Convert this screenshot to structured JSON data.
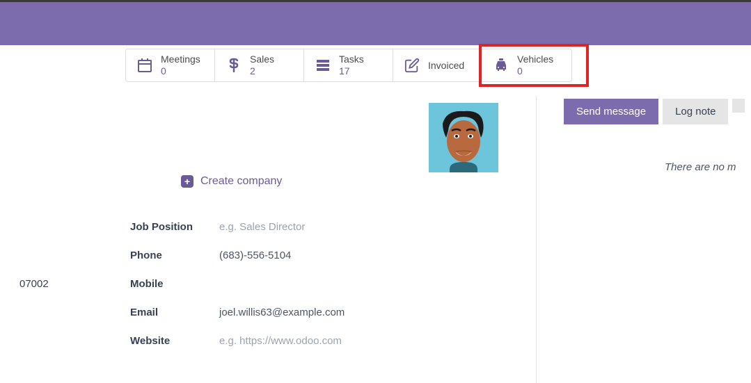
{
  "stats": {
    "meetings": {
      "label": "Meetings",
      "value": "0"
    },
    "sales": {
      "label": "Sales",
      "value": "2"
    },
    "tasks": {
      "label": "Tasks",
      "value": "17"
    },
    "invoiced": {
      "label": "Invoiced"
    },
    "vehicles": {
      "label": "Vehicles",
      "value": "0"
    }
  },
  "create_company_label": "Create company",
  "zip": "07002",
  "details": {
    "job_position": {
      "label": "Job Position",
      "placeholder": "e.g. Sales Director"
    },
    "phone": {
      "label": "Phone",
      "value": "(683)-556-5104"
    },
    "mobile": {
      "label": "Mobile"
    },
    "email": {
      "label": "Email",
      "value": "joel.willis63@example.com"
    },
    "website": {
      "label": "Website",
      "placeholder": "e.g. https://www.odoo.com"
    }
  },
  "messaging": {
    "send": "Send message",
    "log": "Log note",
    "empty": "There are no m"
  }
}
